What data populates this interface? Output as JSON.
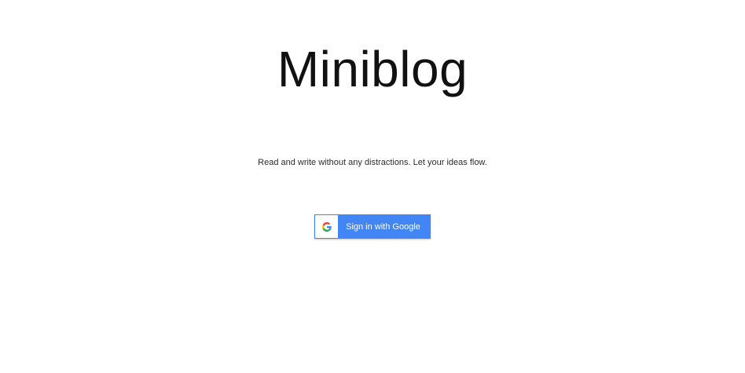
{
  "app": {
    "title": "Miniblog",
    "tagline": "Read and write without any distractions. Let your ideas flow."
  },
  "signin": {
    "button_label": "Sign in with Google",
    "icon": "google-g-icon",
    "button_color": "#4285f4",
    "logo_colors": {
      "blue": "#4285f4",
      "red": "#ea4335",
      "yellow": "#fbbc05",
      "green": "#34a853"
    }
  }
}
